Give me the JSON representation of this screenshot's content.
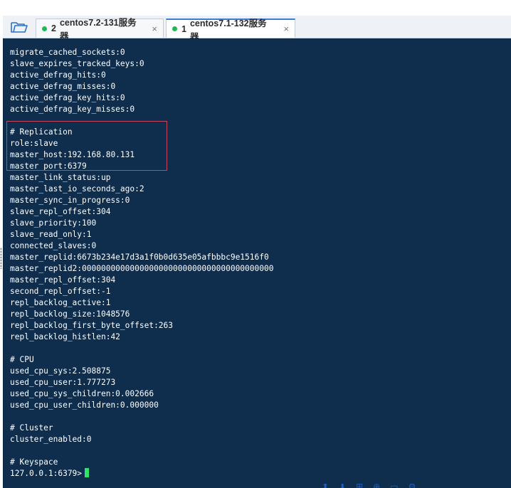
{
  "tabs": [
    {
      "number": "2",
      "label": "centos7.2-131服务器",
      "close": "×",
      "status_color": "#1db954",
      "active": false
    },
    {
      "number": "1",
      "label": "centos7.1-132服务器",
      "close": "×",
      "status_color": "#1db954",
      "active": true
    }
  ],
  "colors": {
    "terminal_bg": "#0f2d4d",
    "terminal_text": "#ffffff",
    "cursor": "#2fe26b",
    "highlight_border": "#c2475a",
    "active_tab_accent": "#3b7dd8"
  },
  "icons": {
    "folder": "folder-icon",
    "status_dot": "status-dot-icon",
    "close": "close-icon"
  },
  "terminal": {
    "lines": [
      "migrate_cached_sockets:0",
      "slave_expires_tracked_keys:0",
      "active_defrag_hits:0",
      "active_defrag_misses:0",
      "active_defrag_key_hits:0",
      "active_defrag_key_misses:0",
      "",
      "# Replication",
      "role:slave",
      "master_host:192.168.80.131",
      "master_port:6379",
      "master_link_status:up",
      "master_last_io_seconds_ago:2",
      "master_sync_in_progress:0",
      "slave_repl_offset:304",
      "slave_priority:100",
      "slave_read_only:1",
      "connected_slaves:0",
      "master_replid:6673b234e17d3a1f0b0d635e05afbbbc9e1516f0",
      "master_replid2:0000000000000000000000000000000000000000",
      "master_repl_offset:304",
      "second_repl_offset:-1",
      "repl_backlog_active:1",
      "repl_backlog_size:1048576",
      "repl_backlog_first_byte_offset:263",
      "repl_backlog_histlen:42",
      "",
      "# CPU",
      "used_cpu_sys:2.508875",
      "used_cpu_user:1.777273",
      "used_cpu_sys_children:0.002666",
      "used_cpu_user_children:0.000000",
      "",
      "# Cluster",
      "cluster_enabled:0",
      "",
      "# Keyspace"
    ],
    "prompt": "127.0.0.1:6379>"
  }
}
